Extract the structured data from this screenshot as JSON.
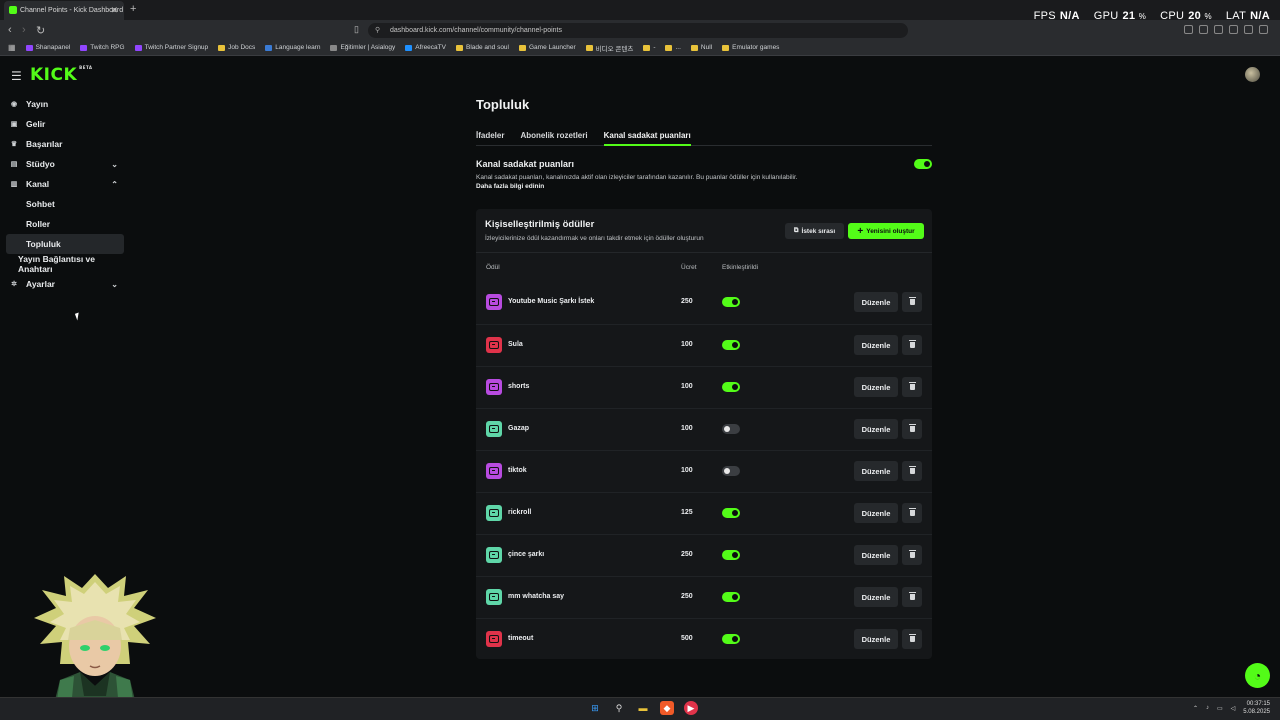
{
  "browser": {
    "tab_title": "Channel Points - Kick Dashboard",
    "new_tab": "+",
    "url": "dashboard.kick.com/channel/community/channel-points",
    "bookmarks": [
      "Shanapanel",
      "Twitch RPG",
      "Twitch Partner Signup",
      "Job Docs",
      "Language learn",
      "Eğitimler | Asialogy",
      "AfreecaTV",
      "Blade and soul",
      "Game Launcher",
      "비디오 콘텐츠",
      "-",
      "...",
      "Null",
      "Emulator games"
    ],
    "bookmark_colors": [
      "#9146ff",
      "#9146ff",
      "#9146ff",
      "#e8c23a",
      "#3a7bd5",
      "#888888",
      "#1e90ff",
      "#e8c23a",
      "#e8c23a",
      "#e8c23a",
      "#e8c23a",
      "#e8c23a",
      "#e8c23a",
      "#e8c23a"
    ]
  },
  "overlay": {
    "fps_label": "FPS",
    "fps_value": "N/A",
    "gpu_label": "GPU",
    "gpu_value": "21",
    "gpu_unit": "%",
    "cpu_label": "CPU",
    "cpu_value": "20",
    "cpu_unit": "%",
    "lat_label": "LAT",
    "lat_value": "N/A"
  },
  "app": {
    "logo": "KICK",
    "logo_badge": "BETA",
    "accent": "#53fc18"
  },
  "sidebar": {
    "items": [
      {
        "label": "Yayın",
        "icon": "broadcast-icon"
      },
      {
        "label": "Gelir",
        "icon": "wallet-icon"
      },
      {
        "label": "Başarılar",
        "icon": "trophy-icon"
      },
      {
        "label": "Stüdyo",
        "icon": "studio-icon",
        "expandable": true
      },
      {
        "label": "Kanal",
        "icon": "channel-icon",
        "expanded": true
      },
      {
        "label": "Sohbet"
      },
      {
        "label": "Roller"
      },
      {
        "label": "Topluluk",
        "active": true
      },
      {
        "label": "Yayın Bağlantısı ve Anahtarı"
      },
      {
        "label": "Ayarlar",
        "icon": "gear-icon",
        "expandable": true
      }
    ]
  },
  "main": {
    "title": "Topluluk",
    "tabs": [
      {
        "label": "İfadeler"
      },
      {
        "label": "Abonelik rozetleri"
      },
      {
        "label": "Kanal sadakat puanları",
        "active": true
      }
    ],
    "section_title": "Kanal sadakat puanları",
    "section_desc": "Kanal sadakat puanları, kanalınızda aktif olan izleyiciler tarafından kazanılır. Bu puanlar ödüller için kullanılabilir.",
    "section_link": "Daha fazla bilgi edinin",
    "enabled": true
  },
  "card": {
    "title": "Kişiselleştirilmiş ödüller",
    "subtitle": "İzleyicilerinize ödül kazandırmak ve onları takdir etmek için ödüller oluşturun",
    "queue_button": "İstek sırası",
    "create_button": "Yenisini oluştur",
    "columns": {
      "reward": "Ödül",
      "cost": "Ücret",
      "enabled": "Etkinleştirildi"
    },
    "edit_label": "Düzenle",
    "rows": [
      {
        "name": "Youtube Music Şarkı İstek",
        "cost": "250",
        "enabled": true,
        "color": "#b84be0"
      },
      {
        "name": "Sula",
        "cost": "100",
        "enabled": true,
        "color": "#e0334a"
      },
      {
        "name": "shorts",
        "cost": "100",
        "enabled": true,
        "color": "#b84be0"
      },
      {
        "name": "Gazap",
        "cost": "100",
        "enabled": false,
        "color": "#5fd6a8"
      },
      {
        "name": "tiktok",
        "cost": "100",
        "enabled": false,
        "color": "#b84be0"
      },
      {
        "name": "rickroll",
        "cost": "125",
        "enabled": true,
        "color": "#5fd6a8"
      },
      {
        "name": "çince şarkı",
        "cost": "250",
        "enabled": true,
        "color": "#5fd6a8"
      },
      {
        "name": "mm whatcha say",
        "cost": "250",
        "enabled": true,
        "color": "#5fd6a8"
      },
      {
        "name": "timeout",
        "cost": "500",
        "enabled": true,
        "color": "#e0334a"
      }
    ]
  },
  "taskbar": {
    "time": "00:37:15",
    "date": "5.08.2025"
  }
}
